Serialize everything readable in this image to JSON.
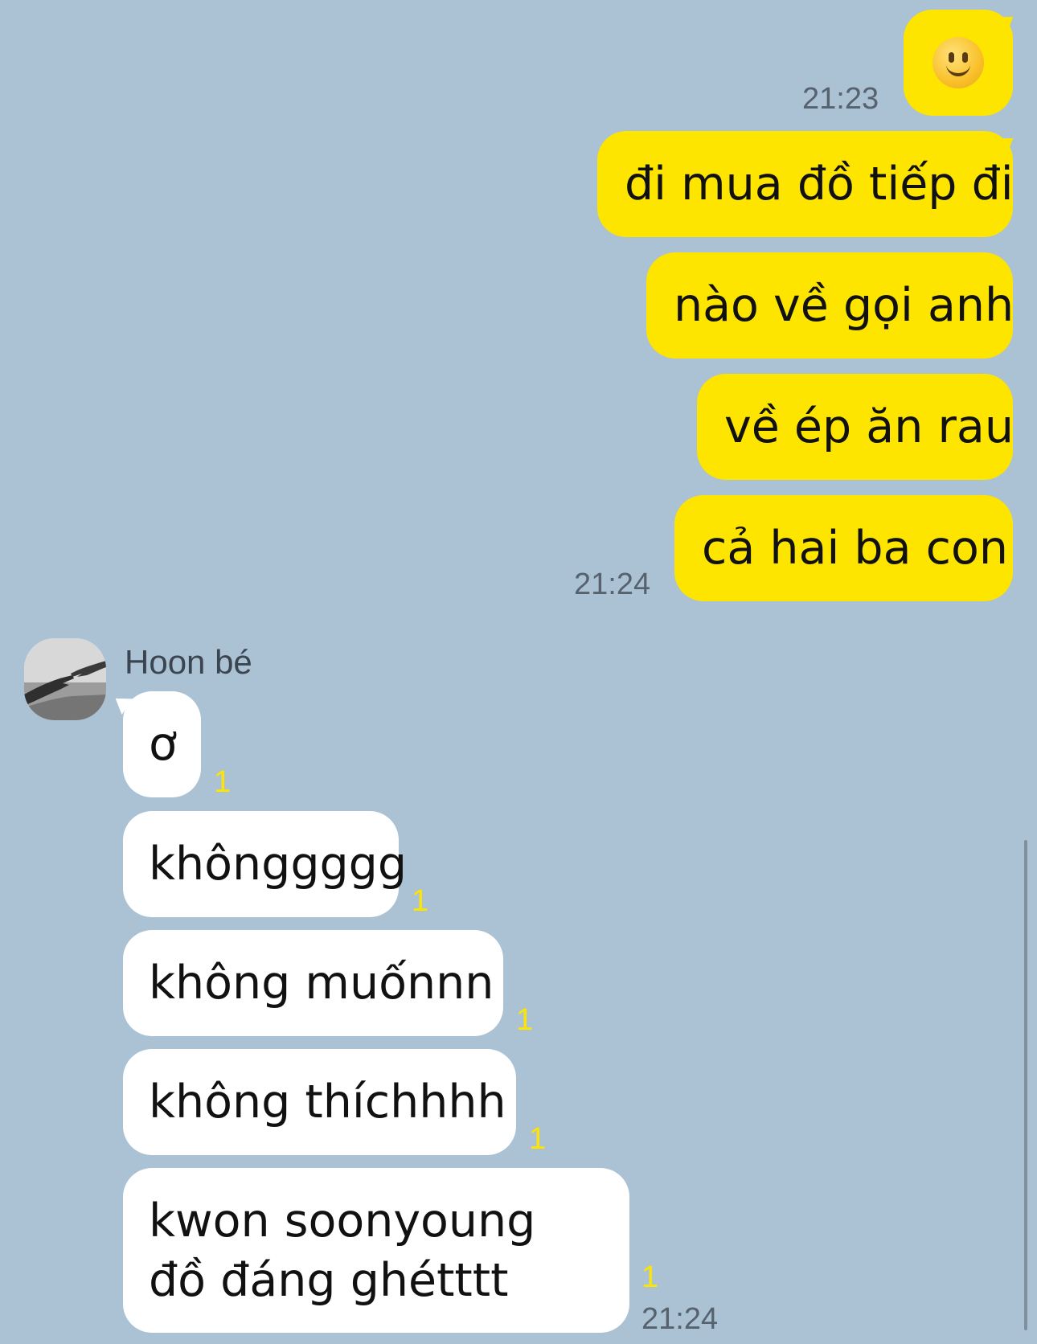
{
  "colors": {
    "background": "#abc1d4",
    "outgoing_bubble": "#fee500",
    "incoming_bubble": "#ffffff",
    "timestamp": "#56636f",
    "unread_count": "#fee500"
  },
  "outgoing": {
    "emoji_icon": "slightly-smiling-face-icon",
    "emoji_time": "21:23",
    "messages": [
      "đi mua đồ tiếp đi",
      "nào về gọi anh",
      "về ép ăn rau",
      "cả hai ba con"
    ],
    "last_time": "21:24"
  },
  "incoming": {
    "sender_name": "Hoon bé",
    "avatar_icon": "hands-reaching-avatar",
    "messages": [
      {
        "text": "ơ",
        "unread": "1"
      },
      {
        "text": "khônggggg",
        "unread": "1"
      },
      {
        "text": "không muốnnn",
        "unread": "1"
      },
      {
        "text": "không thíchhhh",
        "unread": "1"
      },
      {
        "text": "kwon soonyoung đồ đáng ghétttt",
        "unread": "1"
      }
    ],
    "last_time": "21:24"
  }
}
